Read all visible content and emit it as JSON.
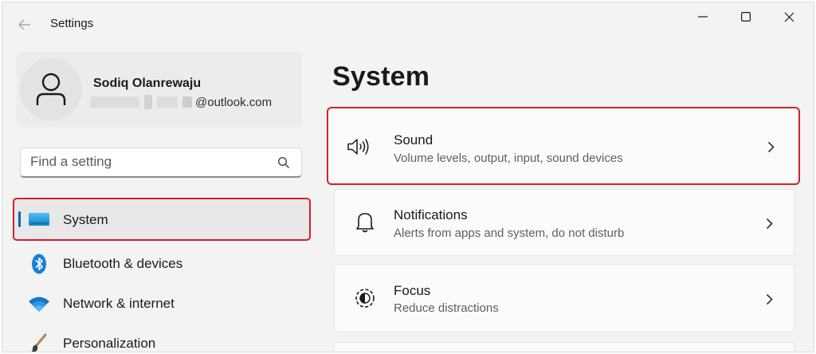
{
  "window": {
    "title": "Settings"
  },
  "profile": {
    "name": "Sodiq Olanrewaju",
    "email_suffix": "@outlook.com"
  },
  "search": {
    "placeholder": "Find a setting"
  },
  "sidebar": {
    "items": [
      {
        "label": "System",
        "icon": "system-icon",
        "selected": true
      },
      {
        "label": "Bluetooth & devices",
        "icon": "bluetooth-icon",
        "selected": false
      },
      {
        "label": "Network & internet",
        "icon": "wifi-icon",
        "selected": false
      },
      {
        "label": "Personalization",
        "icon": "brush-icon",
        "selected": false
      }
    ]
  },
  "main": {
    "title": "System",
    "cards": [
      {
        "title": "Sound",
        "subtitle": "Volume levels, output, input, sound devices",
        "icon": "speaker-icon"
      },
      {
        "title": "Notifications",
        "subtitle": "Alerts from apps and system, do not disturb",
        "icon": "bell-icon"
      },
      {
        "title": "Focus",
        "subtitle": "Reduce distractions",
        "icon": "focus-icon"
      }
    ]
  },
  "colors": {
    "accent": "#0067c0",
    "highlight_red": "#d81e2b",
    "background": "#f3f3f3",
    "card": "#fbfbfb"
  }
}
